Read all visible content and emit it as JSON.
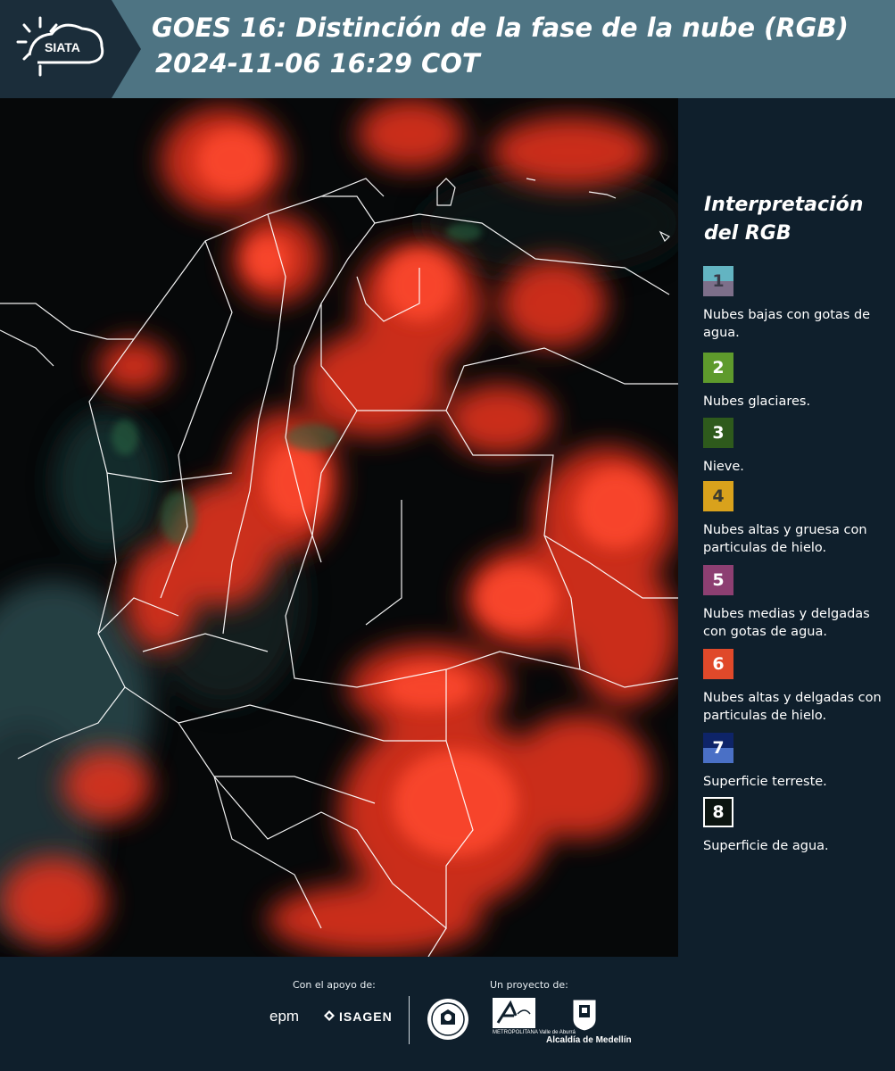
{
  "header": {
    "logo_text": "SIATA",
    "title_line1": "GOES 16: Distinción de la fase de la nube (RGB)",
    "title_line2": "2024-11-06 16:29 COT"
  },
  "legend": {
    "title": "Interpretación del RGB",
    "items": [
      {
        "number": "1",
        "label": "Nubes bajas con gotas de agua.",
        "color_top": "#63b4c2",
        "color_bottom": "#7d6f8a"
      },
      {
        "number": "2",
        "label": "Nubes glaciares.",
        "color": "#5e9a2c"
      },
      {
        "number": "3",
        "label": "Nieve.",
        "color": "#2e5a1c"
      },
      {
        "number": "4",
        "label": "Nubes altas y gruesa con particulas de hielo.",
        "color": "#d9a21c"
      },
      {
        "number": "5",
        "label": "Nubes medias y delgadas con gotas de agua.",
        "color": "#8d3f72"
      },
      {
        "number": "6",
        "label": "Nubes altas y delgadas con particulas de hielo.",
        "color": "#e0492a"
      },
      {
        "number": "7",
        "label": "Superficie terreste.",
        "color_top": "#0e2468",
        "color_bottom": "#4a70c6"
      },
      {
        "number": "8",
        "label": "Superficie de agua.",
        "color": "#0b1410"
      }
    ]
  },
  "footer": {
    "support_label": "Con el apoyo de:",
    "project_label": "Un proyecto de:",
    "sponsor1": "epm",
    "sponsor2": "ISAGEN",
    "partner_metro": "METROPOLITANA Valle de Aburrá",
    "partner_metro_logo": "Área",
    "partner_alcaldia": "Alcaldía de Medellín"
  },
  "colors": {
    "header_bg": "#4e7483",
    "panel_bg": "#0f1f2c",
    "cloud_red": "#ff3b22",
    "border_white": "#ffffff"
  }
}
